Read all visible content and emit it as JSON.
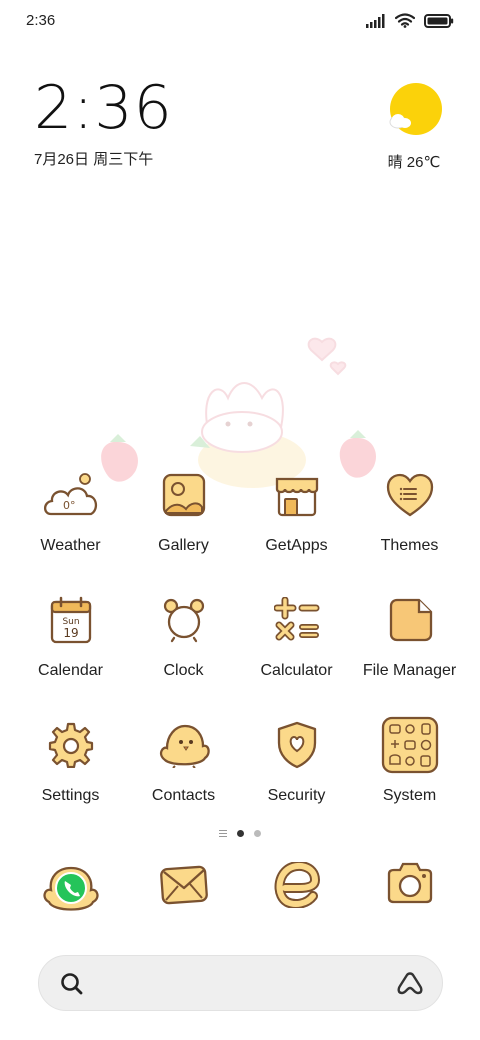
{
  "status_bar": {
    "time": "2:36",
    "icons": [
      "signal-icon",
      "wifi-icon",
      "battery-icon"
    ]
  },
  "clock_widget": {
    "time": "2:36",
    "date": "7月26日 周三下午"
  },
  "weather_widget": {
    "condition_temp": "晴 26℃",
    "icon": "sunny-cloud-icon"
  },
  "apps": [
    {
      "label": "Weather",
      "icon": "weather-cloud-icon",
      "badge": "0°"
    },
    {
      "label": "Gallery",
      "icon": "gallery-icon"
    },
    {
      "label": "GetApps",
      "icon": "store-icon"
    },
    {
      "label": "Themes",
      "icon": "heart-icon"
    },
    {
      "label": "Calendar",
      "icon": "calendar-icon",
      "day": "Sun",
      "date": "19"
    },
    {
      "label": "Clock",
      "icon": "alarm-clock-icon"
    },
    {
      "label": "Calculator",
      "icon": "calculator-icon"
    },
    {
      "label": "File Manager",
      "icon": "folder-icon"
    },
    {
      "label": "Settings",
      "icon": "gear-icon"
    },
    {
      "label": "Contacts",
      "icon": "chick-icon"
    },
    {
      "label": "Security",
      "icon": "shield-icon"
    },
    {
      "label": "System",
      "icon": "system-folder-icon"
    }
  ],
  "page_indicator": {
    "pages": 3,
    "active": 1
  },
  "dock": [
    "phone-icon",
    "mail-icon",
    "browser-icon",
    "camera-icon"
  ],
  "search_bar": {
    "left_icon": "search-icon",
    "right_icon": "assistant-icon"
  },
  "colors": {
    "icon_fill": "#fbd98a",
    "icon_stroke": "#7a5230",
    "sun": "#fbd20a",
    "phone_green": "#25c45a"
  }
}
